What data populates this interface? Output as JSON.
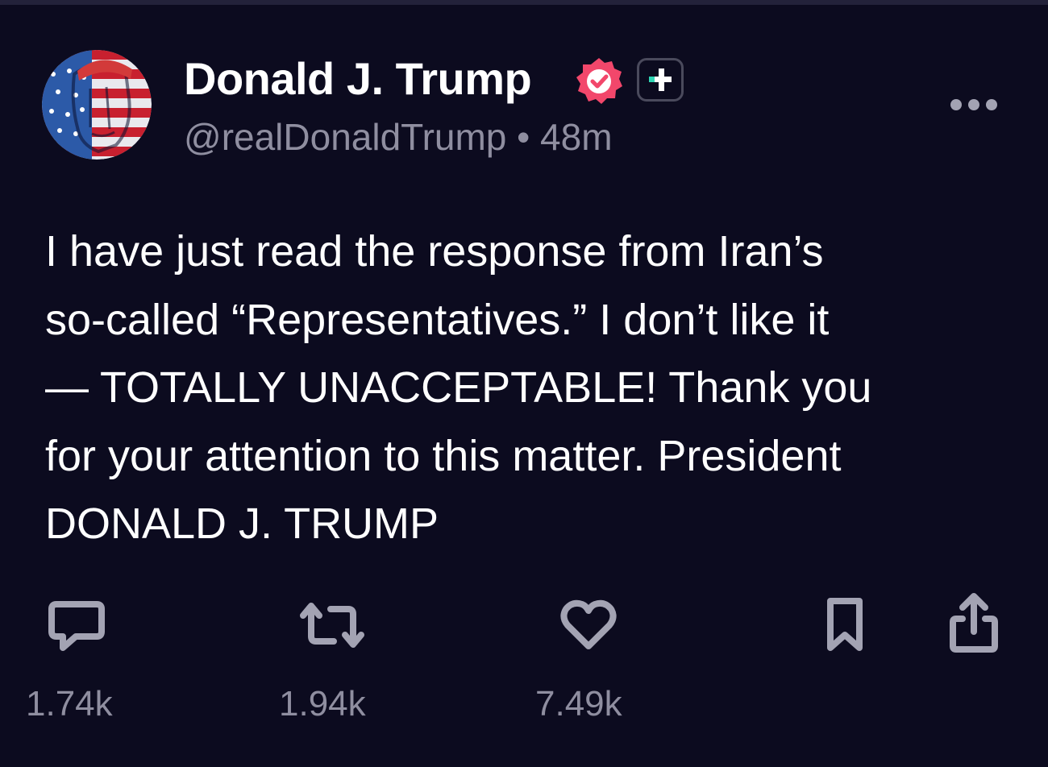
{
  "post": {
    "author": {
      "display_name": "Donald J. Trump",
      "handle": "@realDonaldTrump",
      "separator": "•",
      "time_ago": "48m",
      "verified": true
    },
    "body_lines": [
      "I have just read the response from Iran’s",
      "so-called “Representatives.” I don’t like it",
      "— TOTALLY UNACCEPTABLE! Thank you",
      "for your attention to this matter. President",
      "DONALD J. TRUMP"
    ],
    "actions": {
      "reply_count": "1.74k",
      "repost_count": "1.94k",
      "like_count": "7.49k"
    }
  },
  "icons": {
    "reply": "speech-bubble-icon",
    "repost": "repost-arrows-icon",
    "like": "heart-icon",
    "bookmark": "bookmark-icon",
    "share": "share-icon",
    "more": "more-dots-icon",
    "verified": "verified-badge-icon",
    "plus": "plus-badge-icon"
  },
  "colors": {
    "background": "#0c0b1f",
    "primary_text": "#ffffff",
    "secondary_text": "#8f8ea0",
    "verified_badge": "#f2476b",
    "icon_gray": "#a3a3b3",
    "plus_accent": "#2fd6b5"
  }
}
